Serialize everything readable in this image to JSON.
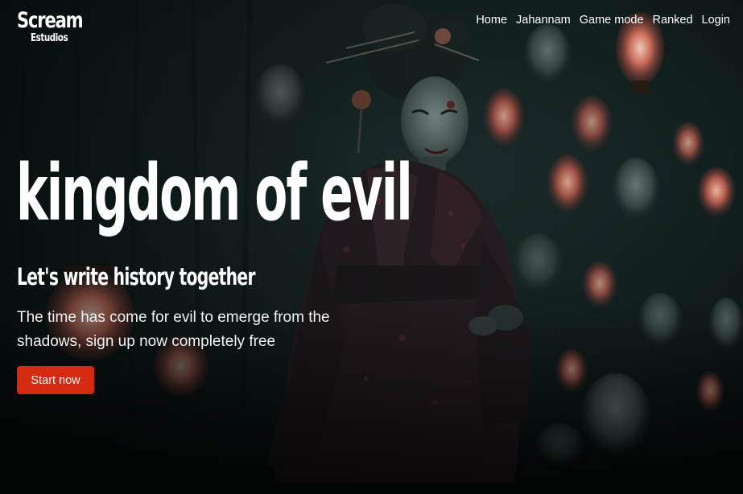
{
  "brand": {
    "name": "Scream",
    "subname": "Estudios"
  },
  "nav": {
    "items": [
      {
        "label": "Home"
      },
      {
        "label": "Jahannam"
      },
      {
        "label": "Game mode"
      },
      {
        "label": "Ranked"
      },
      {
        "label": "Login"
      }
    ]
  },
  "hero": {
    "headline": "kingdom of evil",
    "subheadline": "Let's write history together",
    "description": "The time has come for evil to emerge from the shadows, sign up now completely free",
    "cta_label": "Start now",
    "image_subject": "masked woman in kimono among floating oni masks and lanterns",
    "colors": {
      "accent": "#d42a12",
      "background": "#0b1414",
      "text": "#ffffff"
    }
  }
}
